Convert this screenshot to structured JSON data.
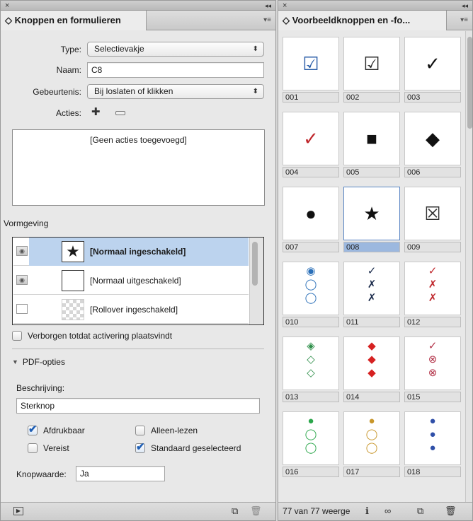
{
  "left_panel": {
    "close": "×",
    "collapse": "◂◂",
    "tab_title": "◇ Knoppen en formulieren",
    "tab_menu": "▾≡",
    "type_label": "Type:",
    "type_value": "Selectievakje",
    "name_label": "Naam:",
    "name_value": "C8",
    "event_label": "Gebeurtenis:",
    "event_value": "Bij loslaten of klikken",
    "actions_label": "Acties:",
    "actions_empty": "[Geen acties toegevoegd]",
    "appearance_label": "Vormgeving",
    "states": [
      {
        "label": "[Normaal ingeschakeld]",
        "thumb": "★"
      },
      {
        "label": "[Normaal uitgeschakeld]",
        "thumb": ""
      },
      {
        "label": "[Rollover ingeschakeld]",
        "thumb": ""
      }
    ],
    "hidden_label": "Verborgen totdat activering plaatsvindt",
    "pdf_options_label": "PDF-opties",
    "description_label": "Beschrijving:",
    "description_value": "Sterknop",
    "printable_label": "Afdrukbaar",
    "readonly_label": "Alleen-lezen",
    "required_label": "Vereist",
    "default_selected_label": "Standaard geselecteerd",
    "button_value_label": "Knopwaarde:",
    "button_value": "Ja",
    "printable_checked": true,
    "readonly_checked": false,
    "required_checked": false,
    "default_selected_checked": true
  },
  "right_panel": {
    "close": "×",
    "collapse": "◂◂",
    "tab_title": "◇ Voorbeeldknoppen en -fo...",
    "tab_menu": "▾≡",
    "items": [
      {
        "label": "001",
        "glyph": "☑"
      },
      {
        "label": "002",
        "glyph": "☑"
      },
      {
        "label": "003",
        "glyph": "✓"
      },
      {
        "label": "004",
        "glyph": "✓"
      },
      {
        "label": "005",
        "glyph": "■"
      },
      {
        "label": "006",
        "glyph": "◆"
      },
      {
        "label": "007",
        "glyph": "●"
      },
      {
        "label": "008",
        "glyph": "★"
      },
      {
        "label": "009",
        "glyph": "☒"
      },
      {
        "label": "010",
        "glyph": "◉ ◯ ◯"
      },
      {
        "label": "011",
        "glyph": "✓ ✗ ✗"
      },
      {
        "label": "012",
        "glyph": "✓ ✗ ✗"
      },
      {
        "label": "013",
        "glyph": "◈ ◇ ◇"
      },
      {
        "label": "014",
        "glyph": "◆ ◆ ◆"
      },
      {
        "label": "015",
        "glyph": "✓ ⊗ ⊗"
      },
      {
        "label": "016",
        "glyph": "● ◯ ◯"
      },
      {
        "label": "017",
        "glyph": "● ◯ ◯"
      },
      {
        "label": "018",
        "glyph": "● ● ●"
      }
    ],
    "status_text": "77 van 77 weerge"
  }
}
